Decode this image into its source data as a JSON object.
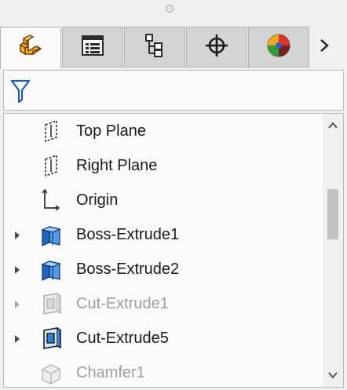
{
  "window": {
    "title": ""
  },
  "tabs": [
    {
      "name": "FeatureManager design tree",
      "icon": "feature-manager-icon",
      "active": true
    },
    {
      "name": "PropertyManager",
      "icon": "property-manager-icon",
      "active": false
    },
    {
      "name": "ConfigurationManager",
      "icon": "configuration-manager-icon",
      "active": false
    },
    {
      "name": "DimXpertManager",
      "icon": "dimxpert-icon",
      "active": false
    },
    {
      "name": "DisplayManager",
      "icon": "display-manager-icon",
      "active": false
    }
  ],
  "tab_next_icon": "chevron-right-icon",
  "filter": {
    "icon": "funnel-icon"
  },
  "tree": {
    "items": [
      {
        "label": "Top Plane",
        "icon": "plane-icon",
        "expandable": false,
        "suppressed": false
      },
      {
        "label": "Right Plane",
        "icon": "plane-icon",
        "expandable": false,
        "suppressed": false
      },
      {
        "label": "Origin",
        "icon": "origin-icon",
        "expandable": false,
        "suppressed": false
      },
      {
        "label": "Boss-Extrude1",
        "icon": "boss-extrude-icon",
        "expandable": true,
        "suppressed": false
      },
      {
        "label": "Boss-Extrude2",
        "icon": "boss-extrude-icon",
        "expandable": true,
        "suppressed": false
      },
      {
        "label": "Cut-Extrude1",
        "icon": "cut-extrude-icon",
        "expandable": true,
        "suppressed": true
      },
      {
        "label": "Cut-Extrude5",
        "icon": "cut-extrude-icon",
        "expandable": true,
        "suppressed": false
      },
      {
        "label": "Chamfer1",
        "icon": "chamfer-icon",
        "expandable": false,
        "suppressed": true
      }
    ]
  },
  "colors": {
    "panel_bg": "#f0f0f0",
    "tree_bg": "#fbfbfb",
    "text": "#1a1a1a",
    "suppressed_text": "#9e9e9e",
    "feature_blue": "#2f7fd3",
    "part_orange": "#f0a020"
  }
}
